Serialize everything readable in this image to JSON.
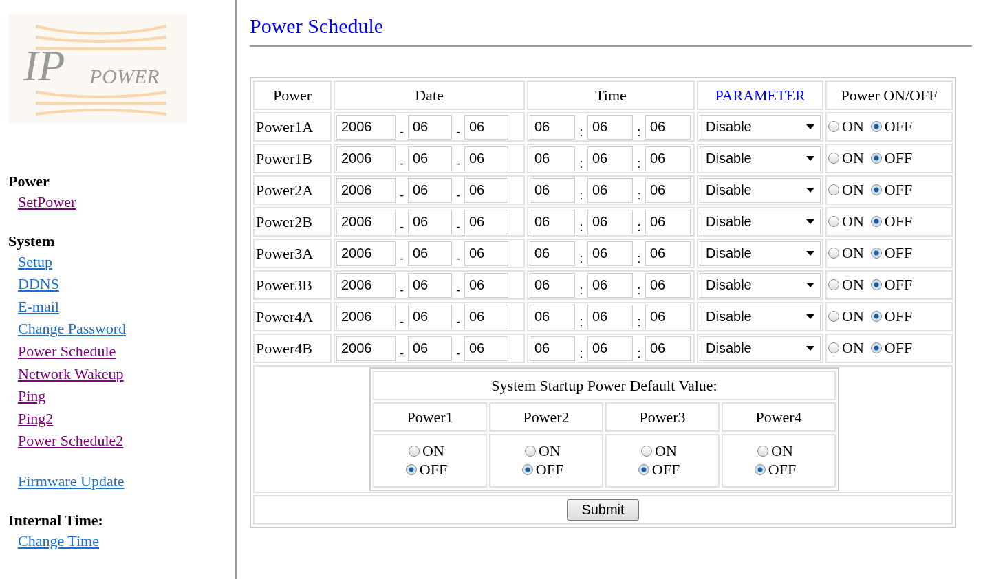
{
  "logo": {
    "big": "IP",
    "small": "POWER"
  },
  "sidebar": {
    "sections": [
      {
        "title": "Power",
        "links": [
          {
            "label": "SetPower",
            "visited": true
          }
        ]
      },
      {
        "title": "System",
        "links": [
          {
            "label": "Setup",
            "visited": false
          },
          {
            "label": "DDNS",
            "visited": false
          },
          {
            "label": "E-mail",
            "visited": false
          },
          {
            "label": "Change Password",
            "visited": false
          },
          {
            "label": "Power Schedule",
            "visited": true
          },
          {
            "label": "Network Wakeup",
            "visited": true
          },
          {
            "label": "Ping",
            "visited": true
          },
          {
            "label": "Ping2",
            "visited": true
          },
          {
            "label": "Power Schedule2",
            "visited": true
          }
        ]
      },
      {
        "links": [
          {
            "label": "Firmware Update",
            "visited": false
          }
        ]
      },
      {
        "title": "Internal Time:",
        "links": [
          {
            "label": "Change Time",
            "visited": false
          }
        ]
      }
    ]
  },
  "page_title": "Power Schedule",
  "table": {
    "columns": [
      "Power",
      "Date",
      "Time",
      "PARAMETER",
      "Power ON/OFF"
    ],
    "rows": [
      {
        "name": "Power1A",
        "date": [
          "2006",
          "06",
          "06"
        ],
        "time": [
          "06",
          "06",
          "06"
        ],
        "parameter": "Disable",
        "options": [
          {
            "label": "ON",
            "selected": false
          },
          {
            "label": "OFF",
            "selected": true
          }
        ]
      },
      {
        "name": "Power1B",
        "date": [
          "2006",
          "06",
          "06"
        ],
        "time": [
          "06",
          "06",
          "06"
        ],
        "parameter": "Disable",
        "options": [
          {
            "label": "ON",
            "selected": false
          },
          {
            "label": "OFF",
            "selected": true
          }
        ]
      },
      {
        "name": "Power2A",
        "date": [
          "2006",
          "06",
          "06"
        ],
        "time": [
          "06",
          "06",
          "06"
        ],
        "parameter": "Disable",
        "options": [
          {
            "label": "ON",
            "selected": false
          },
          {
            "label": "OFF",
            "selected": true
          }
        ]
      },
      {
        "name": "Power2B",
        "date": [
          "2006",
          "06",
          "06"
        ],
        "time": [
          "06",
          "06",
          "06"
        ],
        "parameter": "Disable",
        "options": [
          {
            "label": "ON",
            "selected": false
          },
          {
            "label": "OFF",
            "selected": true
          }
        ]
      },
      {
        "name": "Power3A",
        "date": [
          "2006",
          "06",
          "06"
        ],
        "time": [
          "06",
          "06",
          "06"
        ],
        "parameter": "Disable",
        "options": [
          {
            "label": "ON",
            "selected": false
          },
          {
            "label": "OFF",
            "selected": true
          }
        ]
      },
      {
        "name": "Power3B",
        "date": [
          "2006",
          "06",
          "06"
        ],
        "time": [
          "06",
          "06",
          "06"
        ],
        "parameter": "Disable",
        "options": [
          {
            "label": "ON",
            "selected": false
          },
          {
            "label": "OFF",
            "selected": true
          }
        ]
      },
      {
        "name": "Power4A",
        "date": [
          "2006",
          "06",
          "06"
        ],
        "time": [
          "06",
          "06",
          "06"
        ],
        "parameter": "Disable",
        "options": [
          {
            "label": "ON",
            "selected": false
          },
          {
            "label": "OFF",
            "selected": true
          }
        ]
      },
      {
        "name": "Power4B",
        "date": [
          "2006",
          "06",
          "06"
        ],
        "time": [
          "06",
          "06",
          "06"
        ],
        "parameter": "Disable",
        "options": [
          {
            "label": "ON",
            "selected": false
          },
          {
            "label": "OFF",
            "selected": true
          }
        ]
      }
    ],
    "date_sep": "-",
    "time_sep": ":"
  },
  "startup": {
    "title": "System Startup Power Default Value:",
    "outlets": [
      {
        "name": "Power1",
        "options": [
          {
            "label": "ON",
            "selected": false
          },
          {
            "label": "OFF",
            "selected": true
          }
        ]
      },
      {
        "name": "Power2",
        "options": [
          {
            "label": "ON",
            "selected": false
          },
          {
            "label": "OFF",
            "selected": true
          }
        ]
      },
      {
        "name": "Power3",
        "options": [
          {
            "label": "ON",
            "selected": false
          },
          {
            "label": "OFF",
            "selected": true
          }
        ]
      },
      {
        "name": "Power4",
        "options": [
          {
            "label": "ON",
            "selected": false
          },
          {
            "label": "OFF",
            "selected": true
          }
        ]
      }
    ]
  },
  "submit": "Submit"
}
